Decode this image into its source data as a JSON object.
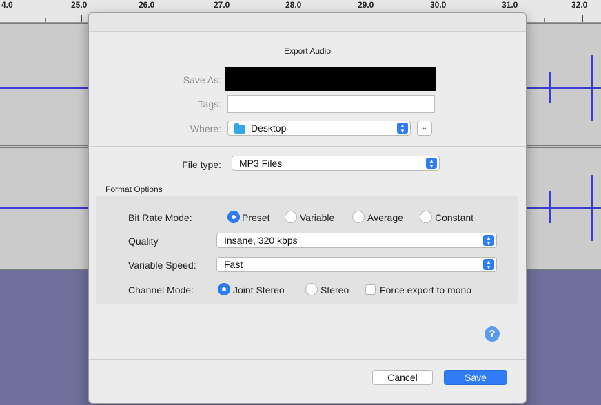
{
  "ruler": {
    "ticks": [
      "4.0",
      "25.0",
      "26.0",
      "27.0",
      "28.0",
      "29.0",
      "30.0",
      "31.0",
      "32.0"
    ]
  },
  "dialog": {
    "title": "Export Audio",
    "save_as_label": "Save As:",
    "save_as_value": "",
    "tags_label": "Tags:",
    "tags_value": "",
    "where_label": "Where:",
    "where_value": "Desktop",
    "where_icon": "folder-icon",
    "file_type_label": "File type:",
    "file_type_value": "MP3 Files",
    "format_options_title": "Format Options",
    "bit_rate_mode": {
      "label": "Bit Rate Mode:",
      "options": [
        "Preset",
        "Variable",
        "Average",
        "Constant"
      ],
      "selected": "Preset"
    },
    "quality": {
      "label": "Quality",
      "value": "Insane, 320 kbps"
    },
    "variable_speed": {
      "label": "Variable Speed:",
      "value": "Fast"
    },
    "channel_mode": {
      "label": "Channel Mode:",
      "options": [
        "Joint Stereo",
        "Stereo"
      ],
      "selected": "Joint Stereo",
      "force_mono_label": "Force export to mono",
      "force_mono_checked": false
    },
    "help_glyph": "?",
    "cancel_label": "Cancel",
    "save_label": "Save"
  }
}
